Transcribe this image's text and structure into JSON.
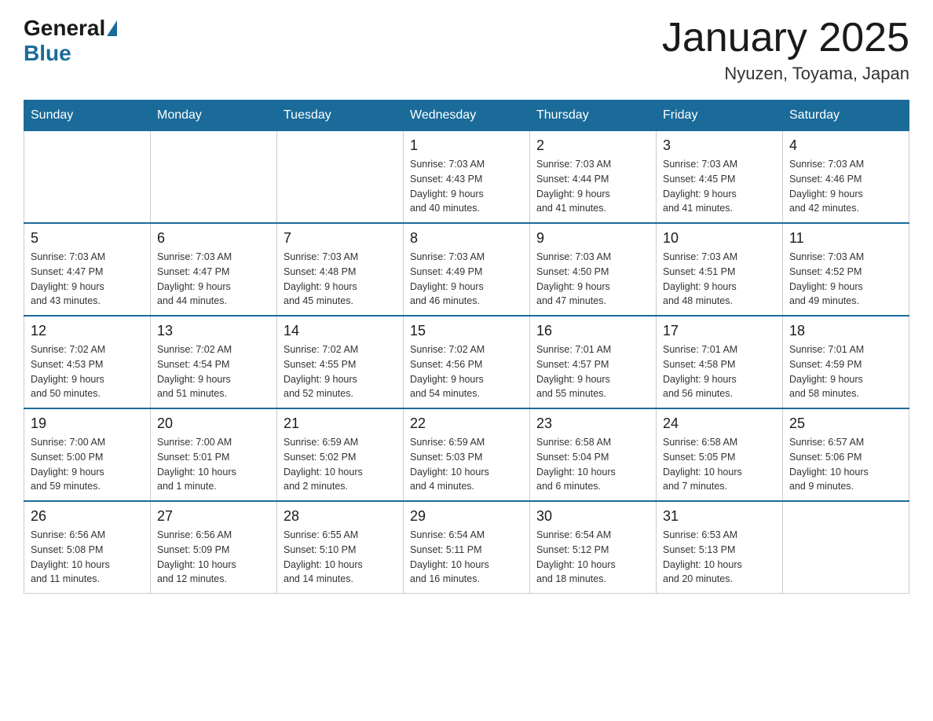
{
  "header": {
    "title": "January 2025",
    "subtitle": "Nyuzen, Toyama, Japan",
    "logo": {
      "general": "General",
      "blue": "Blue"
    }
  },
  "days_of_week": [
    "Sunday",
    "Monday",
    "Tuesday",
    "Wednesday",
    "Thursday",
    "Friday",
    "Saturday"
  ],
  "weeks": [
    [
      {
        "day": "",
        "info": ""
      },
      {
        "day": "",
        "info": ""
      },
      {
        "day": "",
        "info": ""
      },
      {
        "day": "1",
        "info": "Sunrise: 7:03 AM\nSunset: 4:43 PM\nDaylight: 9 hours\nand 40 minutes."
      },
      {
        "day": "2",
        "info": "Sunrise: 7:03 AM\nSunset: 4:44 PM\nDaylight: 9 hours\nand 41 minutes."
      },
      {
        "day": "3",
        "info": "Sunrise: 7:03 AM\nSunset: 4:45 PM\nDaylight: 9 hours\nand 41 minutes."
      },
      {
        "day": "4",
        "info": "Sunrise: 7:03 AM\nSunset: 4:46 PM\nDaylight: 9 hours\nand 42 minutes."
      }
    ],
    [
      {
        "day": "5",
        "info": "Sunrise: 7:03 AM\nSunset: 4:47 PM\nDaylight: 9 hours\nand 43 minutes."
      },
      {
        "day": "6",
        "info": "Sunrise: 7:03 AM\nSunset: 4:47 PM\nDaylight: 9 hours\nand 44 minutes."
      },
      {
        "day": "7",
        "info": "Sunrise: 7:03 AM\nSunset: 4:48 PM\nDaylight: 9 hours\nand 45 minutes."
      },
      {
        "day": "8",
        "info": "Sunrise: 7:03 AM\nSunset: 4:49 PM\nDaylight: 9 hours\nand 46 minutes."
      },
      {
        "day": "9",
        "info": "Sunrise: 7:03 AM\nSunset: 4:50 PM\nDaylight: 9 hours\nand 47 minutes."
      },
      {
        "day": "10",
        "info": "Sunrise: 7:03 AM\nSunset: 4:51 PM\nDaylight: 9 hours\nand 48 minutes."
      },
      {
        "day": "11",
        "info": "Sunrise: 7:03 AM\nSunset: 4:52 PM\nDaylight: 9 hours\nand 49 minutes."
      }
    ],
    [
      {
        "day": "12",
        "info": "Sunrise: 7:02 AM\nSunset: 4:53 PM\nDaylight: 9 hours\nand 50 minutes."
      },
      {
        "day": "13",
        "info": "Sunrise: 7:02 AM\nSunset: 4:54 PM\nDaylight: 9 hours\nand 51 minutes."
      },
      {
        "day": "14",
        "info": "Sunrise: 7:02 AM\nSunset: 4:55 PM\nDaylight: 9 hours\nand 52 minutes."
      },
      {
        "day": "15",
        "info": "Sunrise: 7:02 AM\nSunset: 4:56 PM\nDaylight: 9 hours\nand 54 minutes."
      },
      {
        "day": "16",
        "info": "Sunrise: 7:01 AM\nSunset: 4:57 PM\nDaylight: 9 hours\nand 55 minutes."
      },
      {
        "day": "17",
        "info": "Sunrise: 7:01 AM\nSunset: 4:58 PM\nDaylight: 9 hours\nand 56 minutes."
      },
      {
        "day": "18",
        "info": "Sunrise: 7:01 AM\nSunset: 4:59 PM\nDaylight: 9 hours\nand 58 minutes."
      }
    ],
    [
      {
        "day": "19",
        "info": "Sunrise: 7:00 AM\nSunset: 5:00 PM\nDaylight: 9 hours\nand 59 minutes."
      },
      {
        "day": "20",
        "info": "Sunrise: 7:00 AM\nSunset: 5:01 PM\nDaylight: 10 hours\nand 1 minute."
      },
      {
        "day": "21",
        "info": "Sunrise: 6:59 AM\nSunset: 5:02 PM\nDaylight: 10 hours\nand 2 minutes."
      },
      {
        "day": "22",
        "info": "Sunrise: 6:59 AM\nSunset: 5:03 PM\nDaylight: 10 hours\nand 4 minutes."
      },
      {
        "day": "23",
        "info": "Sunrise: 6:58 AM\nSunset: 5:04 PM\nDaylight: 10 hours\nand 6 minutes."
      },
      {
        "day": "24",
        "info": "Sunrise: 6:58 AM\nSunset: 5:05 PM\nDaylight: 10 hours\nand 7 minutes."
      },
      {
        "day": "25",
        "info": "Sunrise: 6:57 AM\nSunset: 5:06 PM\nDaylight: 10 hours\nand 9 minutes."
      }
    ],
    [
      {
        "day": "26",
        "info": "Sunrise: 6:56 AM\nSunset: 5:08 PM\nDaylight: 10 hours\nand 11 minutes."
      },
      {
        "day": "27",
        "info": "Sunrise: 6:56 AM\nSunset: 5:09 PM\nDaylight: 10 hours\nand 12 minutes."
      },
      {
        "day": "28",
        "info": "Sunrise: 6:55 AM\nSunset: 5:10 PM\nDaylight: 10 hours\nand 14 minutes."
      },
      {
        "day": "29",
        "info": "Sunrise: 6:54 AM\nSunset: 5:11 PM\nDaylight: 10 hours\nand 16 minutes."
      },
      {
        "day": "30",
        "info": "Sunrise: 6:54 AM\nSunset: 5:12 PM\nDaylight: 10 hours\nand 18 minutes."
      },
      {
        "day": "31",
        "info": "Sunrise: 6:53 AM\nSunset: 5:13 PM\nDaylight: 10 hours\nand 20 minutes."
      },
      {
        "day": "",
        "info": ""
      }
    ]
  ]
}
